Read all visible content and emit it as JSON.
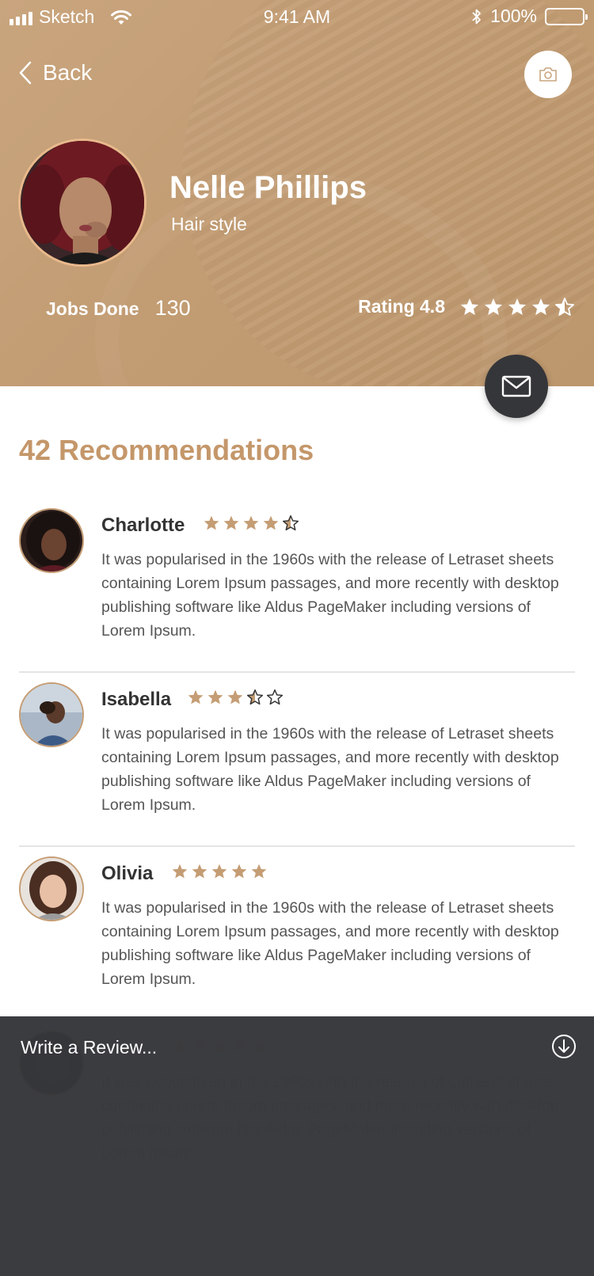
{
  "status_bar": {
    "carrier": "Sketch",
    "time": "9:41 AM",
    "battery": "100%"
  },
  "nav": {
    "back_label": "Back"
  },
  "profile": {
    "name": "Nelle Phillips",
    "subtitle": "Hair style",
    "jobs_label": "Jobs Done",
    "jobs_value": "130",
    "rating_label": "Rating 4.8",
    "rating_stars": 4.5
  },
  "recommendations": {
    "title": "42 Recommendations",
    "items": [
      {
        "name": "Charlotte",
        "stars": 4.5,
        "text": "It was popularised in the 1960s with the release of Letraset sheets containing Lorem Ipsum passages, and more recently with desktop publishing software like Aldus PageMaker including versions of Lorem Ipsum."
      },
      {
        "name": "Isabella",
        "stars": 3.5,
        "text": "It was popularised in the 1960s with the release of Letraset sheets containing Lorem Ipsum passages, and more recently with desktop publishing software like Aldus PageMaker including versions of Lorem Ipsum."
      },
      {
        "name": "Olivia",
        "stars": 5,
        "text": "It was popularised in the 1960s with the release of Letraset sheets containing Lorem Ipsum passages, and more recently with desktop publishing software like Aldus PageMaker including versions of Lorem Ipsum."
      },
      {
        "name": "",
        "stars": 5,
        "text": "It was popularised in the 1960s with the release of Letraset sheets containing Lorem Ipsum passages, and more recently with desktop publishing software like Aldus PageMaker including versions of Lorem Ipsum."
      }
    ]
  },
  "review_sheet": {
    "placeholder": "Write a Review..."
  },
  "colors": {
    "header_bg": "#c29c73",
    "accent": "#c4976a",
    "dark": "#353639",
    "star_gold": "#c59d74"
  }
}
